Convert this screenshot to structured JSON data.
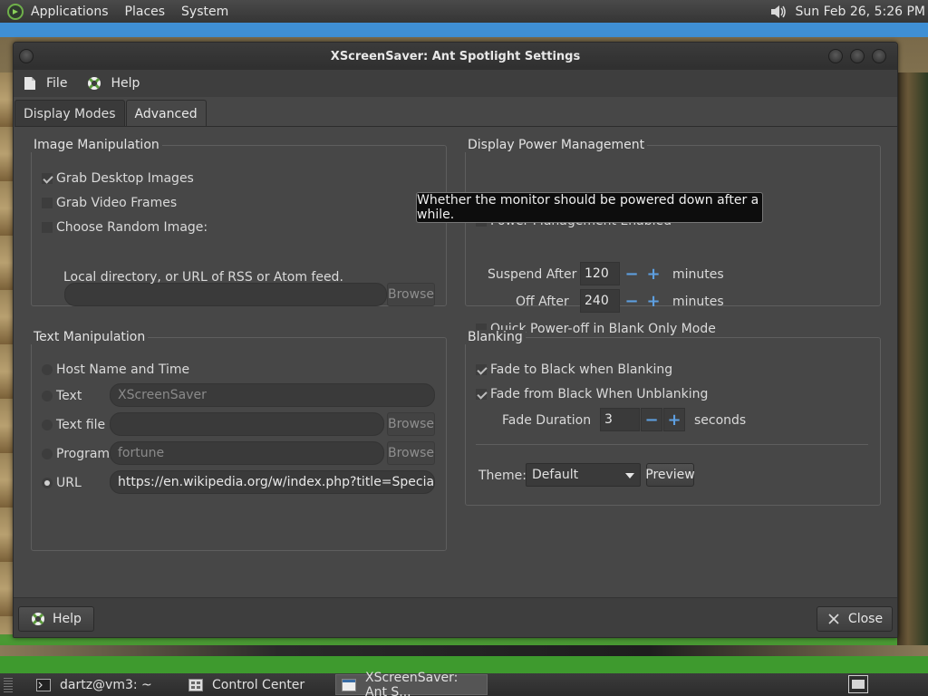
{
  "top_panel": {
    "applications": "Applications",
    "places": "Places",
    "system": "System",
    "clock": "Sun Feb 26,  5:26 PM"
  },
  "window": {
    "title": "XScreenSaver: Ant Spotlight Settings"
  },
  "menubar": {
    "file": "File",
    "help": "Help"
  },
  "tabs": [
    {
      "label": "Display Modes",
      "active": false
    },
    {
      "label": "Advanced",
      "active": true
    }
  ],
  "image_manipulation": {
    "title": "Image Manipulation",
    "grab_desktop": "Grab Desktop Images",
    "grab_video": "Grab Video Frames",
    "choose_random": "Choose Random Image:",
    "random_path_value": "",
    "browse": "Browse",
    "hint": "Local directory, or URL of RSS or Atom feed."
  },
  "text_manipulation": {
    "title": "Text Manipulation",
    "host_name": "Host Name and Time",
    "text_label": "Text",
    "text_value": "XScreenSaver",
    "text_file_label": "Text file",
    "text_file_value": "",
    "program_label": "Program",
    "program_value": "fortune",
    "url_label": "URL",
    "url_value": "https://en.wikipedia.org/w/index.php?title=Special:NewPa",
    "browse": "Browse"
  },
  "power_management": {
    "title": "Display Power Management",
    "enabled": "Power Management Enabled",
    "suspend_label": "Suspend After",
    "suspend_value": "120",
    "off_label": "Off After",
    "off_value": "240",
    "minutes": "minutes",
    "quick_off": "Quick Power-off in Blank Only Mode"
  },
  "blanking": {
    "title": "Blanking",
    "fade_to_black": "Fade to Black when Blanking",
    "fade_from_black": "Fade from Black When Unblanking",
    "fade_duration_label": "Fade Duration",
    "fade_duration_value": "3",
    "seconds": "seconds",
    "theme_label": "Theme:",
    "theme_value": "Default",
    "preview": "Preview"
  },
  "tooltip": "Whether the monitor should be powered down after a while.",
  "bottom": {
    "help": "Help",
    "close": "Close"
  },
  "taskbar": {
    "terminal": "dartz@vm3: ~",
    "control_center": "Control Center",
    "xscreensaver": "XScreenSaver: Ant S..."
  },
  "colors": {
    "spin_accent": "#5e9fe0",
    "window_bg": "#474747"
  }
}
